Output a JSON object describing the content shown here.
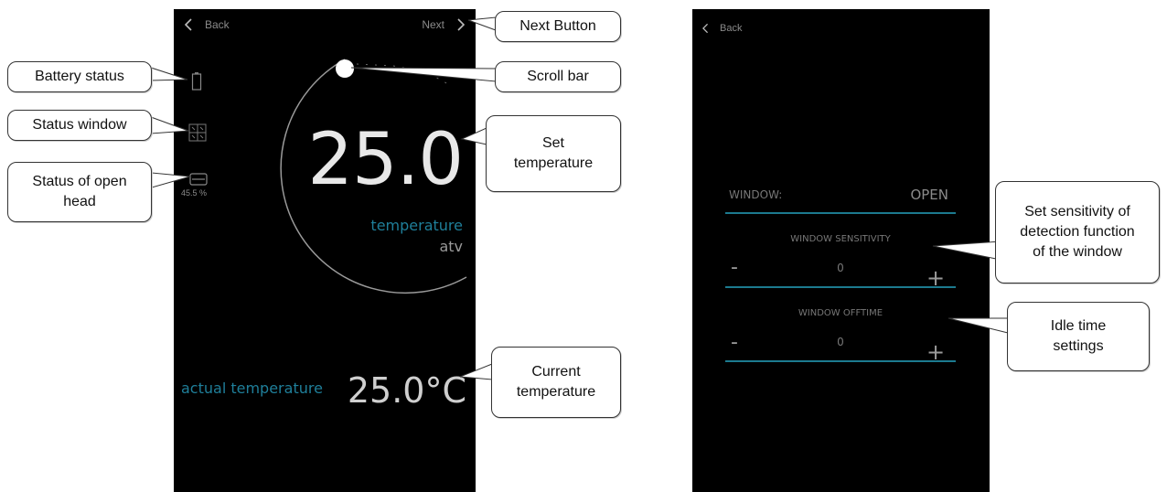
{
  "main_screen": {
    "back_label": "Back",
    "next_label": "Next",
    "battery_percent": "45.5 %",
    "set_temperature": "25.0",
    "temperature_label": "temperature",
    "mode_label": "atv",
    "actual_label": "actual temperature",
    "actual_value": "25.0°C",
    "accent_color": "#1f7f9a"
  },
  "window_screen": {
    "back_label": "Back",
    "window_label": "WINDOW:",
    "window_value": "OPEN",
    "sensitivity_label": "WINDOW SENSITIVITY",
    "sensitivity_value": "0",
    "offtime_label": "WINDOW OFFTIME",
    "offtime_value": "0",
    "minus": "-",
    "plus": "+"
  },
  "callouts": {
    "next_button": "Next Button",
    "scroll_bar": "Scroll bar",
    "battery_status": "Battery status",
    "status_window": "Status window",
    "status_open_head_1": "Status of open",
    "status_open_head_2": "head",
    "set_temp_1": "Set",
    "set_temp_2": "temperature",
    "current_temp_1": "Current",
    "current_temp_2": "temperature",
    "sensitivity_1": "Set sensitivity of",
    "sensitivity_2": "detection function",
    "sensitivity_3": "of the window",
    "idle_1": "Idle time",
    "idle_2": "settings"
  }
}
